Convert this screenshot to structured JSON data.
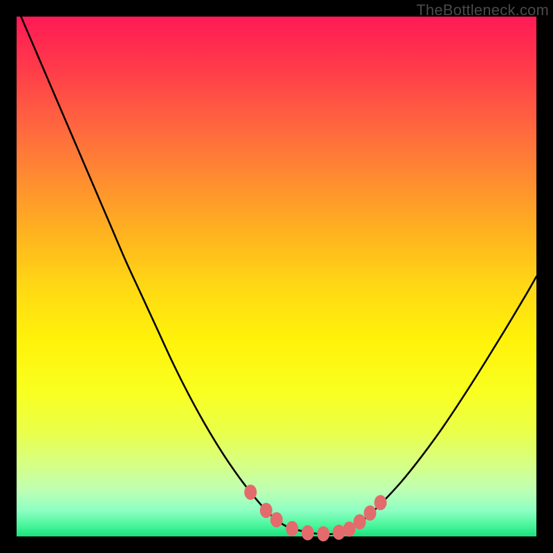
{
  "watermark": "TheBottleneck.com",
  "colors": {
    "frame": "#000000",
    "curve_stroke": "#000000",
    "marker_fill": "#e46b6b",
    "marker_stroke": "#c24848"
  },
  "chart_data": {
    "type": "line",
    "title": "",
    "xlabel": "",
    "ylabel": "",
    "xlim": [
      0,
      100
    ],
    "ylim": [
      0,
      100
    ],
    "grid": false,
    "legend": false,
    "x": [
      0,
      3,
      6,
      9,
      12,
      15,
      18,
      21,
      24,
      27,
      30,
      33,
      36,
      39,
      42,
      45,
      48,
      50,
      52,
      55,
      58,
      61,
      64,
      67,
      70,
      74,
      78,
      82,
      86,
      90,
      94,
      98,
      100
    ],
    "values": [
      102,
      95,
      88,
      81,
      74,
      67,
      60,
      53,
      46.5,
      40,
      33.5,
      27.5,
      22,
      17,
      12.5,
      8.5,
      5,
      3.2,
      1.9,
      1.0,
      0.5,
      0.5,
      1.4,
      3.4,
      6.2,
      10.5,
      15.5,
      21.0,
      27.0,
      33.3,
      39.8,
      46.5,
      50
    ],
    "markers": [
      {
        "x": 45,
        "y": 8.5
      },
      {
        "x": 48,
        "y": 5.0
      },
      {
        "x": 50,
        "y": 3.2
      },
      {
        "x": 53,
        "y": 1.5
      },
      {
        "x": 56,
        "y": 0.7
      },
      {
        "x": 59,
        "y": 0.5
      },
      {
        "x": 62,
        "y": 0.8
      },
      {
        "x": 64,
        "y": 1.4
      },
      {
        "x": 66,
        "y": 2.8
      },
      {
        "x": 68,
        "y": 4.5
      },
      {
        "x": 70,
        "y": 6.5
      }
    ],
    "marker_rx": 9,
    "marker_ry": 11
  }
}
